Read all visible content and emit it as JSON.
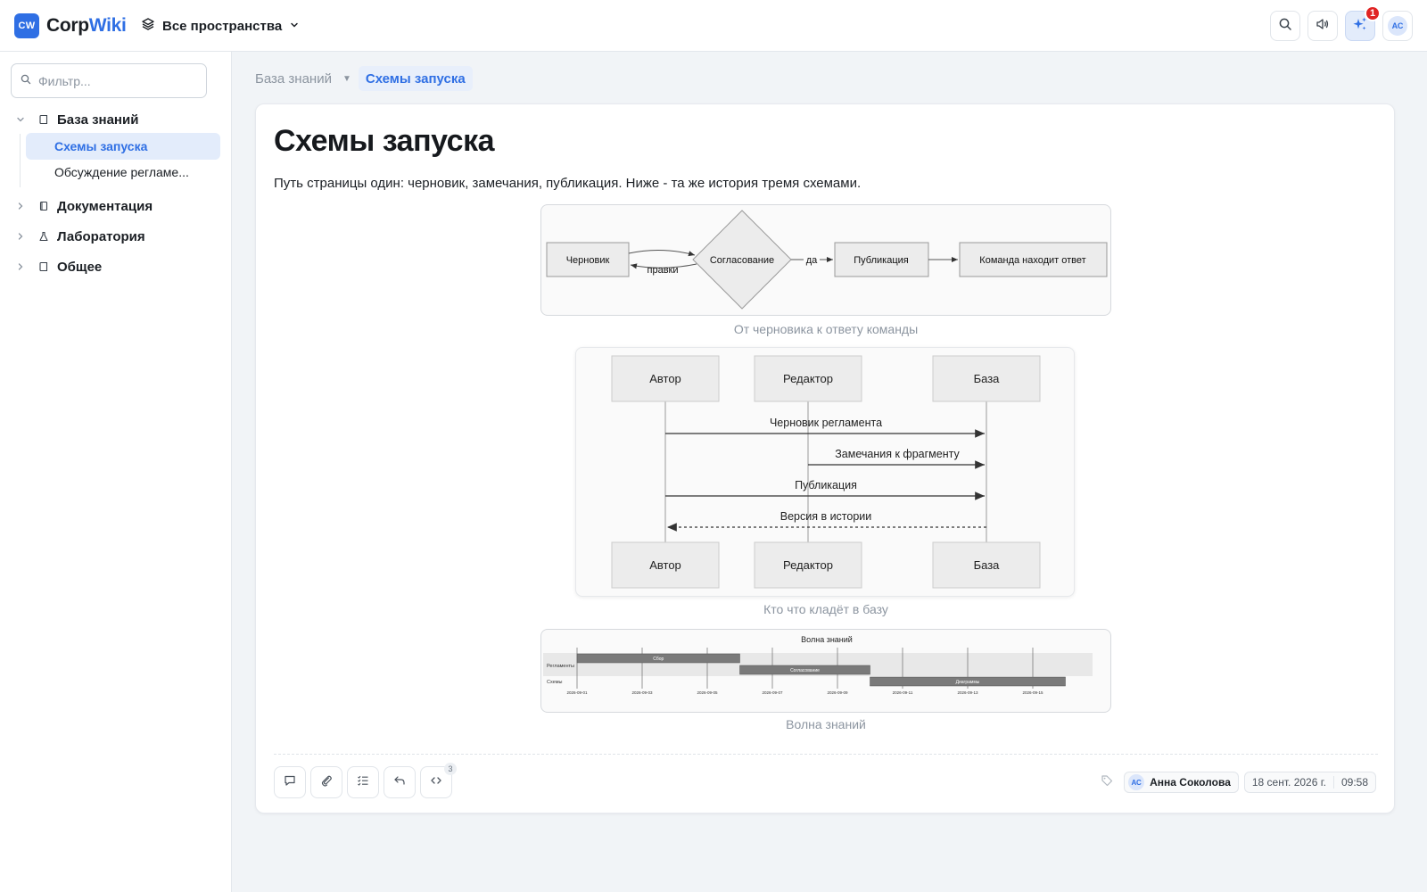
{
  "app": {
    "logo_mark": "CW",
    "logo_name_a": "Corp",
    "logo_name_b": "Wiki"
  },
  "spaces_label": "Все пространства",
  "topbar": {
    "icons": [
      "search-icon",
      "megaphone-icon",
      "sparkles-icon",
      "user-avatar"
    ],
    "notification_count": "1",
    "user_initials": "АС"
  },
  "sidebar": {
    "filter_placeholder": "Фильтр...",
    "sections": [
      {
        "label": "База знаний",
        "expanded": true,
        "children": [
          "Схемы запуска",
          "Обсуждение регламе..."
        ]
      },
      {
        "label": "Документация",
        "expanded": false
      },
      {
        "label": "Лаборатория",
        "expanded": false
      },
      {
        "label": "Общее",
        "expanded": false
      }
    ],
    "active_child": "Схемы запуска"
  },
  "breadcrumb": {
    "parent": "База знаний",
    "current": "Схемы запуска"
  },
  "page": {
    "title": "Схемы запуска",
    "intro": "Путь страницы один: черновик, замечания, публикация. Ниже - та же история тремя схемами."
  },
  "flowchart": {
    "nodes": {
      "draft": "Черновик",
      "review": "Согласование",
      "publish": "Публикация",
      "answer": "Команда находит ответ"
    },
    "edges": {
      "back": "правки",
      "yes": "да"
    },
    "caption": "От черновика к ответу команды"
  },
  "sequence": {
    "actors": [
      "Автор",
      "Редактор",
      "База"
    ],
    "messages": [
      "Черновик регламента",
      "Замечания к фрагменту",
      "Публикация",
      "Версия в истории"
    ],
    "caption": "Кто что кладёт в базу"
  },
  "gantt": {
    "title": "Волна знаний",
    "sections": [
      "Регламенты",
      "Схемы"
    ],
    "tasks": [
      {
        "label": "Сбор",
        "start": "2026-09-01",
        "end": "2026-09-06"
      },
      {
        "label": "Согласование",
        "start": "2026-09-06",
        "end": "2026-09-10"
      },
      {
        "label": "Диаграммы",
        "start": "2026-09-10",
        "end": "2026-09-16"
      }
    ],
    "ticks": [
      "2026-09-01",
      "2026-09-03",
      "2026-09-05",
      "2026-09-07",
      "2026-09-09",
      "2026-09-11",
      "2026-09-13",
      "2026-09-15"
    ],
    "caption": "Волна знаний"
  },
  "footer": {
    "action_icons": [
      "comment-icon",
      "paperclip-icon",
      "checklist-icon",
      "undo-icon",
      "code-icon"
    ],
    "code_count": "3",
    "author_initials": "АС",
    "author_name": "Анна Соколова",
    "date": "18 сент. 2026 г.",
    "time": "09:58"
  }
}
